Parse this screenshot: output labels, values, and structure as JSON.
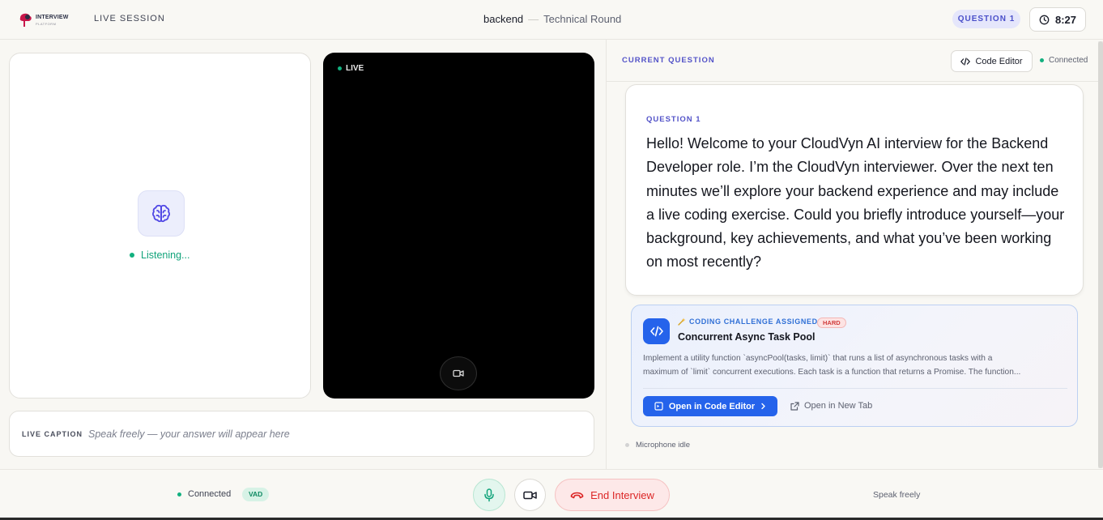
{
  "header": {
    "logo_text": "INTERVIEW",
    "logo_sub": "PLATFORM",
    "session_label": "LIVE SESSION",
    "role": "backend",
    "separator": "—",
    "round": "Technical Round",
    "question_pill": "QUESTION 1",
    "timer": "8:27"
  },
  "ai_panel": {
    "status": "Listening..."
  },
  "video": {
    "live_label": "LIVE"
  },
  "caption": {
    "label": "LIVE CAPTION",
    "placeholder": "Speak freely — your answer will appear here"
  },
  "right_panel": {
    "current_question_label": "CURRENT QUESTION",
    "code_editor_label": "Code Editor",
    "connection_status": "Connected",
    "question": {
      "label": "QUESTION 1",
      "text": "Hello! Welcome to your CloudVyn AI interview for the Backend Developer role. I’m the CloudVyn interviewer. Over the next ten minutes we’ll explore your backend experience and may include a live coding exercise. Could you briefly introduce yourself—your background, key achievements, and what you’ve been working on most recently?"
    },
    "challenge": {
      "assigned_label": "CODING CHALLENGE ASSIGNED",
      "difficulty": "HARD",
      "title": "Concurrent Async Task Pool",
      "description_line1": "Implement a utility function `asyncPool(tasks, limit)` that runs a list of asynchronous tasks with a",
      "description_line2": "maximum of `limit` concurrent executions. Each task is a function that returns a Promise. The function...",
      "open_editor_label": "Open in Code Editor",
      "open_tab_label": "Open in New Tab"
    },
    "microphone_status": "Microphone idle"
  },
  "footer": {
    "connection": "Connected",
    "vad_badge": "VAD",
    "end_label": "End Interview",
    "mode": "Speak freely"
  },
  "colors": {
    "accent": "#5353c8",
    "primary_blue": "#2563eb",
    "success": "#12b07f",
    "danger": "#dc2626"
  },
  "icons": [
    "brain-icon",
    "clock-icon",
    "video-camera-icon",
    "code-icon",
    "external-link-icon",
    "microphone-icon",
    "phone-hangup-icon",
    "chevron-right-icon"
  ]
}
